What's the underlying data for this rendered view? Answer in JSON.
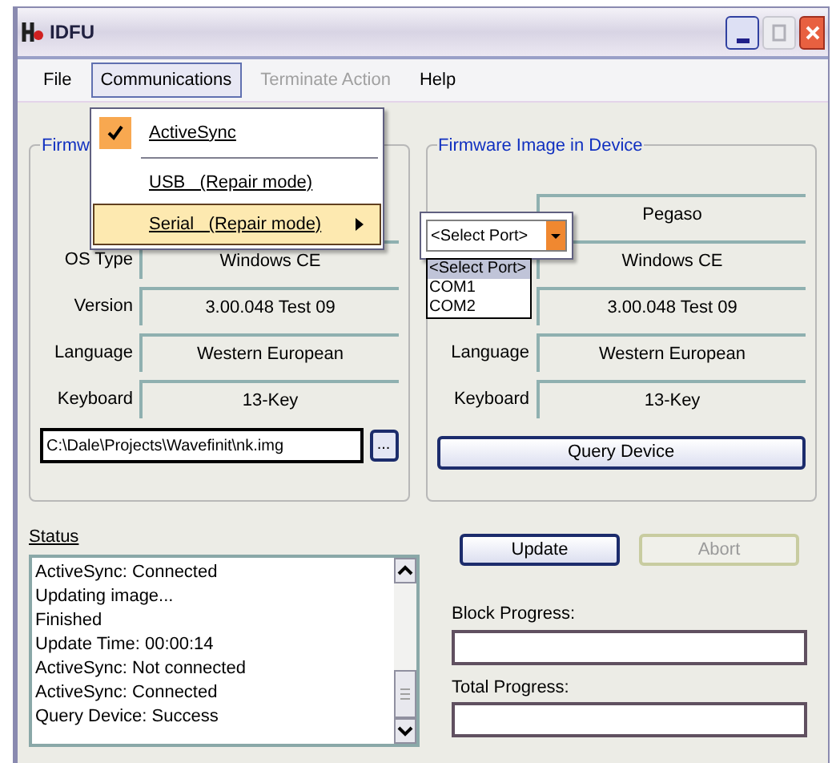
{
  "window": {
    "title": "IDFU"
  },
  "menu": [
    {
      "label": "File",
      "selected": false,
      "disabled": false
    },
    {
      "label": "Communications",
      "selected": true,
      "disabled": false
    },
    {
      "label": "Terminate Action",
      "selected": false,
      "disabled": true
    },
    {
      "label": "Help",
      "selected": false,
      "disabled": false
    }
  ],
  "communications_menu": [
    {
      "kind": "item",
      "label": "ActiveSync",
      "checked": true,
      "highlighted": false,
      "has_submenu": false
    },
    {
      "kind": "separator"
    },
    {
      "kind": "item",
      "label": "USB   (Repair mode)",
      "checked": false,
      "highlighted": false,
      "has_submenu": false
    },
    {
      "kind": "item",
      "label": "Serial   (Repair mode)",
      "checked": false,
      "highlighted": true,
      "has_submenu": true
    }
  ],
  "port_popup": {
    "value": "<Select Port>",
    "options": [
      {
        "label": "<Select Port>",
        "selected": true
      },
      {
        "label": "COM1",
        "selected": false
      },
      {
        "label": "COM2",
        "selected": false
      }
    ]
  },
  "local_image": {
    "title": "Firmw",
    "rows": [
      {
        "label": "OS Type",
        "value": "Windows CE"
      },
      {
        "label": "Version",
        "value": "3.00.048 Test 09"
      },
      {
        "label": "Language",
        "value": "Western European"
      },
      {
        "label": "Keyboard",
        "value": "13-Key"
      }
    ],
    "path_field": {
      "value": "C:\\Dale\\Projects\\Wavefinit\\nk.img"
    },
    "browse_button": "..."
  },
  "device_image": {
    "title": "Firmware Image in Device",
    "rows": [
      {
        "value": "Pegaso"
      },
      {
        "value": "Windows CE"
      },
      {
        "value": "3.00.048 Test 09"
      },
      {
        "label": "Language",
        "value": "Western European"
      },
      {
        "label": "Keyboard",
        "value": "13-Key"
      }
    ],
    "query_button": "Query Device"
  },
  "status": {
    "label": "Status",
    "lines": [
      "ActiveSync: Connected",
      "Updating image...",
      "Finished",
      "Update Time: 00:00:14",
      "ActiveSync: Not connected",
      "ActiveSync: Connected",
      "Query Device: Success"
    ]
  },
  "update_button": {
    "label": "Update",
    "disabled": false
  },
  "abort_button": {
    "label": "Abort",
    "disabled": true
  },
  "block_progress": {
    "label": "Block Progress:",
    "level": 0
  },
  "total_progress": {
    "label": "Total Progress:",
    "level": 0
  }
}
